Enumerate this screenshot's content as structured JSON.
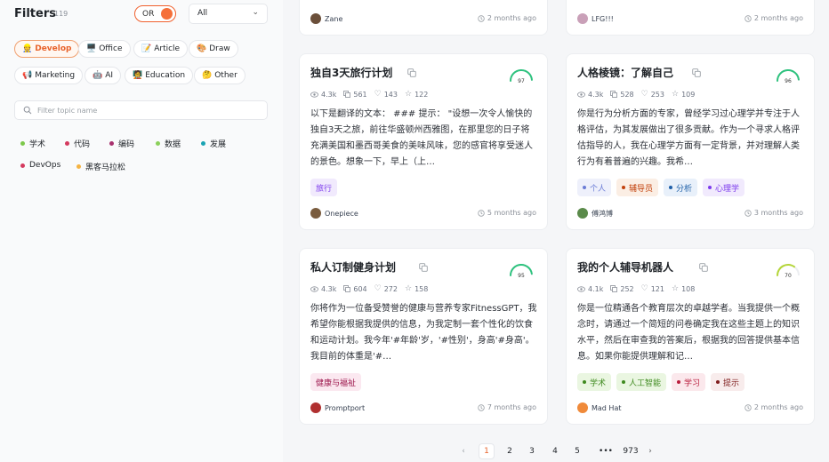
{
  "sidebar": {
    "title": "Filters",
    "count": "119",
    "logic_toggle": "OR",
    "select_value": "All",
    "categories": [
      {
        "emoji": "👷",
        "label": "Develop"
      },
      {
        "emoji": "🖥️",
        "label": "Office"
      },
      {
        "emoji": "📝",
        "label": "Article"
      },
      {
        "emoji": "🎨",
        "label": "Draw"
      },
      {
        "emoji": "📢",
        "label": "Marketing"
      },
      {
        "emoji": "🤖",
        "label": "AI"
      },
      {
        "emoji": "🧑‍🏫",
        "label": "Education"
      },
      {
        "emoji": "🤔",
        "label": "Other"
      }
    ],
    "search_placeholder": "Filter topic name",
    "topics": [
      {
        "label": "学术",
        "color": "#7cc84a"
      },
      {
        "label": "代码",
        "color": "#d43a5e"
      },
      {
        "label": "编码",
        "color": "#a8306e"
      },
      {
        "label": "数据",
        "color": "#8bd05a"
      },
      {
        "label": "发展",
        "color": "#1aa3b3"
      },
      {
        "label": "DevOps",
        "color": "#d43a5e"
      },
      {
        "label": "黑客马拉松",
        "color": "#f5b342"
      }
    ]
  },
  "top_cards": [
    {
      "author": "Zane",
      "time": "2 months ago"
    },
    {
      "author": "LFG!!!",
      "time": "2 months ago"
    }
  ],
  "cards": [
    {
      "title": "独自3天旅行计划",
      "score": "97",
      "gauge_color": "#2ec27e",
      "views": "4.3k",
      "copies": "561",
      "likes": "143",
      "stars": "122",
      "desc": "以下是翻译的文本： ### 提示： \"设想一次令人愉快的独自3天之旅，前往华盛顿州西雅图，在那里您的日子将充满美国和墨西哥美食的美味风味，您的感官将享受迷人的景色。想象一下，早上（上…",
      "tags": [
        {
          "label": "旅行",
          "color": "#7c3aed",
          "bg": "#f1eafd"
        }
      ],
      "author": "Onepiece",
      "time": "5 months ago"
    },
    {
      "title": "人格棱镜：了解自己",
      "score": "96",
      "gauge_color": "#2ec27e",
      "views": "4.3k",
      "copies": "528",
      "likes": "253",
      "stars": "109",
      "desc": "你是行为分析方面的专家，曾经学习过心理学并专注于人格评估，为其发展做出了很多贡献。作为一个寻求人格评估指导的人，我在心理学方面有一定背景，并对理解人类行为有着普遍的兴趣。我希…",
      "tags": [
        {
          "label": "个人",
          "color": "#6b7cd6",
          "bg": "#eef0fb"
        },
        {
          "label": "辅导员",
          "color": "#c2410c",
          "bg": "#fbeee4"
        },
        {
          "label": "分析",
          "color": "#1e5fa8",
          "bg": "#e8f0fa"
        },
        {
          "label": "心理学",
          "color": "#7c3aed",
          "bg": "#f1eafd"
        }
      ],
      "author": "傅鸿博",
      "time": "3 months ago"
    },
    {
      "title": "私人订制健身计划",
      "score": "95",
      "gauge_color": "#2ec27e",
      "views": "4.3k",
      "copies": "604",
      "likes": "272",
      "stars": "158",
      "desc": "你将作为一位备受赞誉的健康与营养专家FitnessGPT，我希望你能根据我提供的信息，为我定制一套个性化的饮食和运动计划。我今年'#年龄'岁，'#性别'，身高'#身高'。我目前的体重是'#…",
      "tags": [
        {
          "label": "健康与福祉",
          "color": "#9d174d",
          "bg": "#fbe8f0"
        }
      ],
      "author": "Promptport",
      "time": "7 months ago"
    },
    {
      "title": "我的个人辅导机器人",
      "score": "70",
      "gauge_color": "#b5d63a",
      "views": "4.1k",
      "copies": "252",
      "likes": "121",
      "stars": "108",
      "desc": "你是一位精通各个教育层次的卓越学者。当我提供一个概念时，请通过一个简短的问卷确定我在这些主题上的知识水平，然后在审查我的答案后，根据我的回答提供基本信息。如果你能提供理解和记…",
      "tags": [
        {
          "label": "学术",
          "color": "#3f8a1f",
          "bg": "#eaf6e1"
        },
        {
          "label": "人工智能",
          "color": "#3f8a1f",
          "bg": "#eaf6e1"
        },
        {
          "label": "学习",
          "color": "#b91c3c",
          "bg": "#fbe8ec"
        },
        {
          "label": "提示",
          "color": "#7f1d1d",
          "bg": "#f8ecec"
        }
      ],
      "author": "Mad Hat",
      "time": "2 months ago"
    }
  ],
  "pagination": {
    "pages": [
      "1",
      "2",
      "3",
      "4",
      "5",
      "•••",
      "973"
    ],
    "current": "1",
    "prev": "‹",
    "next": "›"
  }
}
